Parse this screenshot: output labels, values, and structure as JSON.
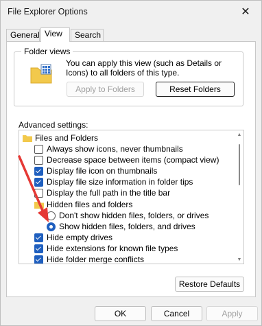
{
  "window": {
    "title": "File Explorer Options",
    "close_glyph": "✕"
  },
  "tabs": [
    {
      "label": "General"
    },
    {
      "label": "View"
    },
    {
      "label": "Search"
    }
  ],
  "folder_views": {
    "label": "Folder views",
    "description": "You can apply this view (such as Details or Icons) to all folders of this type.",
    "apply_button": "Apply to Folders",
    "reset_button": "Reset Folders"
  },
  "advanced": {
    "label": "Advanced settings:",
    "items": [
      {
        "type": "folder",
        "label": "Files and Folders"
      },
      {
        "type": "checkbox",
        "checked": false,
        "label": "Always show icons, never thumbnails"
      },
      {
        "type": "checkbox",
        "checked": false,
        "label": "Decrease space between items (compact view)"
      },
      {
        "type": "checkbox",
        "checked": true,
        "label": "Display file icon on thumbnails"
      },
      {
        "type": "checkbox",
        "checked": true,
        "label": "Display file size information in folder tips"
      },
      {
        "type": "checkbox",
        "checked": false,
        "label": "Display the full path in the title bar"
      },
      {
        "type": "folder",
        "label": "Hidden files and folders"
      },
      {
        "type": "radio",
        "checked": false,
        "label": "Don't show hidden files, folders, or drives"
      },
      {
        "type": "radio",
        "checked": true,
        "label": "Show hidden files, folders, and drives"
      },
      {
        "type": "checkbox",
        "checked": true,
        "label": "Hide empty drives"
      },
      {
        "type": "checkbox",
        "checked": true,
        "label": "Hide extensions for known file types"
      },
      {
        "type": "checkbox",
        "checked": true,
        "label": "Hide folder merge conflicts"
      }
    ],
    "restore_button": "Restore Defaults"
  },
  "footer": {
    "ok": "OK",
    "cancel": "Cancel",
    "apply": "Apply"
  },
  "colors": {
    "accent": "#1f5fbf",
    "annotation_arrow": "#e53935",
    "folder": "#f2c94c"
  }
}
